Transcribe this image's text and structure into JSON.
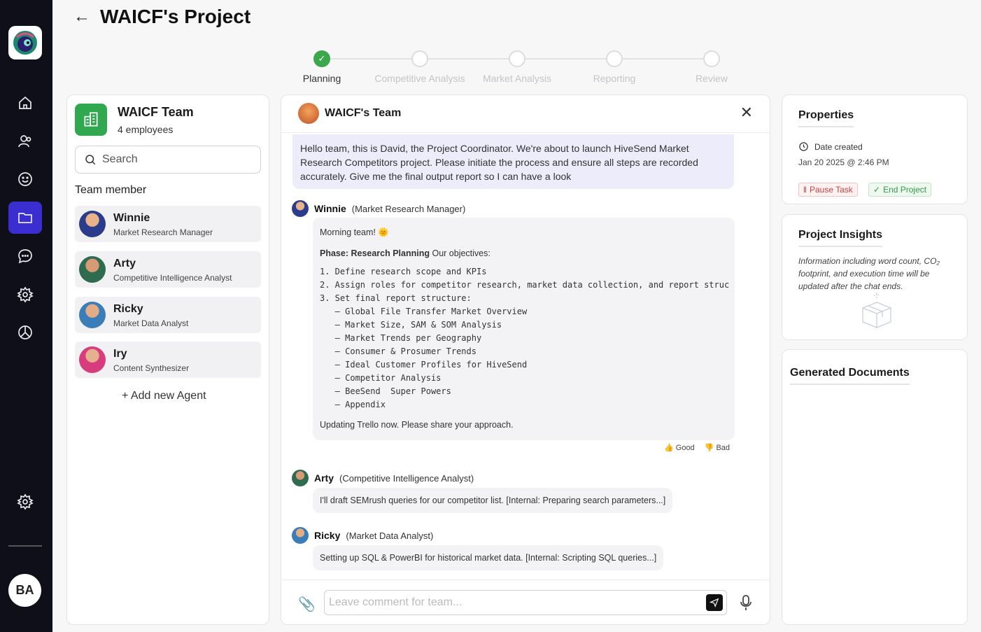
{
  "app": {
    "logo_icon": "robot-logo-icon",
    "user_initials": "BA"
  },
  "sidebar": {
    "items": [
      {
        "icon": "home-icon"
      },
      {
        "icon": "agents-icon"
      },
      {
        "icon": "smile-icon"
      },
      {
        "icon": "folder-icon",
        "active": true
      },
      {
        "icon": "chat-icon"
      },
      {
        "icon": "settings-icon"
      },
      {
        "icon": "pie-chart-icon"
      }
    ],
    "bottom_icon": "gear-icon"
  },
  "header": {
    "title": "WAICF's Project"
  },
  "stepper": {
    "steps": [
      {
        "label": "Planning",
        "done": true
      },
      {
        "label": "Competitive Analysis",
        "done": false
      },
      {
        "label": "Market Analysis",
        "done": false
      },
      {
        "label": "Reporting",
        "done": false
      },
      {
        "label": "Review",
        "done": false
      }
    ]
  },
  "team": {
    "name": "WAICF Team",
    "count": "4 employees",
    "search_placeholder": "Search",
    "section_label": "Team member",
    "members": [
      {
        "name": "Winnie",
        "role": "Market Research Manager",
        "color": "#2b3c8c"
      },
      {
        "name": "Arty",
        "role": "Competitive Intelligence Analyst",
        "color": "#2f6b4f"
      },
      {
        "name": "Ricky",
        "role": "Market Data Analyst",
        "color": "#3a7db8"
      },
      {
        "name": "Iry",
        "role": "Content Synthesizer",
        "color": "#d83c7c"
      }
    ],
    "add_agent": "+ Add new Agent"
  },
  "chat": {
    "title": "WAICF's Team",
    "intro_message": "Hello team, this is David, the Project Coordinator. We're about to launch HiveSend Market Research Competitors project. Please initiate the process and ensure all steps are recorded accurately. Give me the final output report so I can have a look",
    "winnie": {
      "name": "Winnie",
      "role": "(Market Research Manager)",
      "greeting": "Morning team! 🌞",
      "phase_label": "Phase: Research Planning",
      "phase_text": " Our objectives:",
      "objectives": "1. Define research scope and KPIs\n2. Assign roles for competitor research, market data collection, and report struc\n3. Set final report structure:\n   – Global File Transfer Market Overview\n   – Market Size, SAM & SOM Analysis\n   – Market Trends per Geography\n   – Consumer & Prosumer Trends\n   – Ideal Customer Profiles for HiveSend\n   – Competitor Analysis\n   – BeeSend  Super Powers\n   – Appendix",
      "footer": "Updating Trello now. Please share your approach.",
      "good": "Good",
      "bad": "Bad"
    },
    "arty": {
      "name": "Arty",
      "role": "(Competitive Intelligence Analyst)",
      "text": "I'll draft SEMrush queries for our competitor list. [Internal: Preparing search parameters...]"
    },
    "ricky": {
      "name": "Ricky",
      "role": "(Market Data Analyst)",
      "text": "Setting up SQL & PowerBI for historical market data. [Internal: Scripting SQL queries...]"
    },
    "composer_placeholder": "Leave comment for team..."
  },
  "properties": {
    "title": "Properties",
    "date_label": "Date created",
    "date_value": "Jan 20 2025 @ 2:46 PM",
    "pause_label": "Pause Task",
    "end_label": "End Project"
  },
  "insights": {
    "title": "Project Insights",
    "text": "Information including word count, CO₂ footprint, and execution time will be updated after the chat ends."
  },
  "documents": {
    "title": "Generated Documents"
  }
}
